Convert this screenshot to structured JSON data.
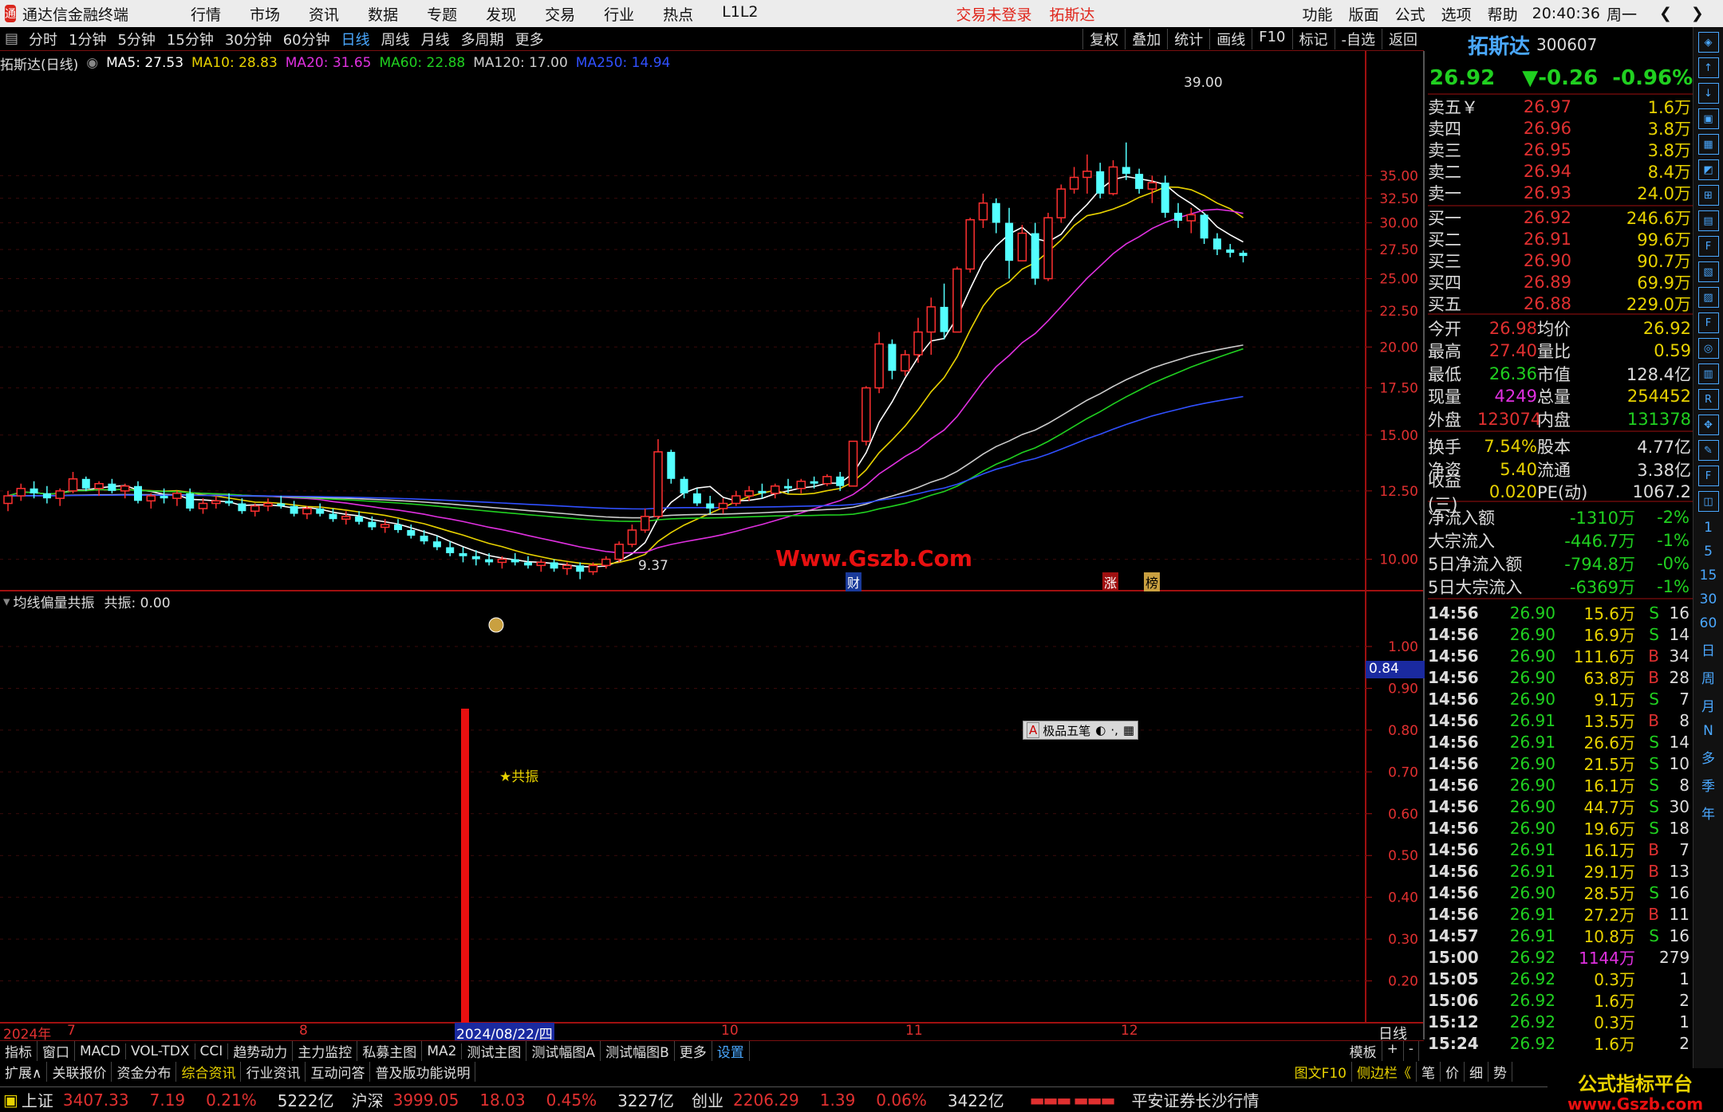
{
  "titlebar": {
    "app_name": "通达信金融终端",
    "menu": [
      "行情",
      "市场",
      "资讯",
      "数据",
      "专题",
      "发现",
      "交易",
      "行业",
      "热点",
      "L1L2"
    ],
    "trade_status": "交易未登录",
    "stock_name": "拓斯达",
    "right_menu": [
      "功能",
      "版面",
      "公式",
      "选项",
      "帮助"
    ],
    "time": "20:40:36",
    "weekday": "周一"
  },
  "period_tabs": [
    "分时",
    "1分钟",
    "5分钟",
    "15分钟",
    "30分钟",
    "60分钟",
    "日线",
    "周线",
    "月线",
    "多周期",
    "更多"
  ],
  "active_period": "日线",
  "chart_tools": [
    "复权",
    "叠加",
    "统计",
    "画线",
    "F10",
    "标记",
    "-自选",
    "返回"
  ],
  "ma_legend": {
    "title": "拓斯达(日线)",
    "items": [
      {
        "label": "MA5: 27.53",
        "color": "#ffffff"
      },
      {
        "label": "MA10: 28.83",
        "color": "#e8d200"
      },
      {
        "label": "MA20: 31.65",
        "color": "#e030e0"
      },
      {
        "label": "MA60: 22.88",
        "color": "#20d020"
      },
      {
        "label": "MA120: 17.00",
        "color": "#cccccc"
      },
      {
        "label": "MA250: 14.94",
        "color": "#3050ff"
      }
    ]
  },
  "price_axis": [
    "35.00",
    "32.50",
    "30.00",
    "27.50",
    "25.00",
    "22.50",
    "20.00",
    "17.50",
    "15.00",
    "12.50",
    "10.00"
  ],
  "annotations": {
    "high": "39.00",
    "low": "9.37",
    "watermark": "Www.Gszb.Com",
    "markers": [
      "财",
      "涨",
      "榜"
    ]
  },
  "sub_chart": {
    "legend_name": "均线偏量共振",
    "legend_value": "共振: 0.00",
    "axis": [
      "1.00",
      "0.90",
      "0.80",
      "0.70",
      "0.60",
      "0.50",
      "0.40",
      "0.30",
      "0.20"
    ],
    "current_value": "0.84",
    "signal_label": "★共振",
    "ime_label": "极品五笔"
  },
  "time_axis": {
    "labels": [
      "2024年",
      "7",
      "8",
      "2024/08/22/四",
      "10",
      "11",
      "12"
    ],
    "period": "日线"
  },
  "stock": {
    "name": "拓斯达",
    "code": "300607",
    "price": "26.92",
    "change": "▼-0.26",
    "pct": "-0.96%"
  },
  "order_book": {
    "asks": [
      {
        "label": "卖五￥",
        "price": "26.97",
        "vol": "1.6万"
      },
      {
        "label": "卖四",
        "price": "26.96",
        "vol": "3.8万"
      },
      {
        "label": "卖三",
        "price": "26.95",
        "vol": "3.8万"
      },
      {
        "label": "卖二",
        "price": "26.94",
        "vol": "8.4万"
      },
      {
        "label": "卖一",
        "price": "26.93",
        "vol": "24.0万"
      }
    ],
    "bids": [
      {
        "label": "买一",
        "price": "26.92",
        "vol": "246.6万"
      },
      {
        "label": "买二",
        "price": "26.91",
        "vol": "99.6万"
      },
      {
        "label": "买三",
        "price": "26.90",
        "vol": "90.7万"
      },
      {
        "label": "买四",
        "price": "26.89",
        "vol": "69.9万"
      },
      {
        "label": "买五",
        "price": "26.88",
        "vol": "229.0万"
      }
    ]
  },
  "stats": [
    [
      {
        "k": "今开",
        "v": "26.98",
        "c": "#e03030"
      },
      {
        "k": "均价",
        "v": "26.92",
        "c": "#e8d200"
      }
    ],
    [
      {
        "k": "最高",
        "v": "27.40",
        "c": "#e03030"
      },
      {
        "k": "量比",
        "v": "0.59",
        "c": "#e8d200"
      }
    ],
    [
      {
        "k": "最低",
        "v": "26.36",
        "c": "#20d020"
      },
      {
        "k": "市值",
        "v": "128.4亿",
        "c": "#ddd"
      }
    ],
    [
      {
        "k": "现量",
        "v": "4249",
        "c": "#e030e0"
      },
      {
        "k": "总量",
        "v": "254452",
        "c": "#e8d200"
      }
    ],
    [
      {
        "k": "外盘",
        "v": "123074",
        "c": "#e03030"
      },
      {
        "k": "内盘",
        "v": "131378",
        "c": "#20d020"
      }
    ],
    [
      {
        "k": "换手",
        "v": "7.54%",
        "c": "#e8d200"
      },
      {
        "k": "股本",
        "v": "4.77亿",
        "c": "#ddd"
      }
    ],
    [
      {
        "k": "净资",
        "v": "5.40",
        "c": "#e8d200"
      },
      {
        "k": "流通",
        "v": "3.38亿",
        "c": "#ddd"
      }
    ],
    [
      {
        "k": "收益(三)",
        "v": "0.020",
        "c": "#e8d200"
      },
      {
        "k": "PE(动)",
        "v": "1067.2",
        "c": "#ddd"
      }
    ]
  ],
  "flows": [
    {
      "k": "净流入额",
      "v": "-1310万",
      "p": "-2%"
    },
    {
      "k": "大宗流入",
      "v": "-446.7万",
      "p": "-1%"
    },
    {
      "k": "5日净流入额",
      "v": "-794.8万",
      "p": "-0%"
    },
    {
      "k": "5日大宗流入",
      "v": "-6369万",
      "p": "-1%"
    }
  ],
  "ticks": [
    {
      "t": "14:56",
      "p": "26.90",
      "v": "15.6万",
      "s": "S",
      "n": "16"
    },
    {
      "t": "14:56",
      "p": "26.90",
      "v": "16.9万",
      "s": "S",
      "n": "14"
    },
    {
      "t": "14:56",
      "p": "26.90",
      "v": "111.6万",
      "s": "B",
      "n": "34"
    },
    {
      "t": "14:56",
      "p": "26.90",
      "v": "63.8万",
      "s": "B",
      "n": "28"
    },
    {
      "t": "14:56",
      "p": "26.90",
      "v": "9.1万",
      "s": "S",
      "n": "7"
    },
    {
      "t": "14:56",
      "p": "26.91",
      "v": "13.5万",
      "s": "B",
      "n": "8"
    },
    {
      "t": "14:56",
      "p": "26.91",
      "v": "26.6万",
      "s": "S",
      "n": "14"
    },
    {
      "t": "14:56",
      "p": "26.90",
      "v": "21.5万",
      "s": "S",
      "n": "10"
    },
    {
      "t": "14:56",
      "p": "26.90",
      "v": "16.1万",
      "s": "S",
      "n": "8"
    },
    {
      "t": "14:56",
      "p": "26.90",
      "v": "44.7万",
      "s": "S",
      "n": "30"
    },
    {
      "t": "14:56",
      "p": "26.90",
      "v": "19.6万",
      "s": "S",
      "n": "18"
    },
    {
      "t": "14:56",
      "p": "26.91",
      "v": "16.1万",
      "s": "B",
      "n": "7"
    },
    {
      "t": "14:56",
      "p": "26.91",
      "v": "29.1万",
      "s": "B",
      "n": "13"
    },
    {
      "t": "14:56",
      "p": "26.90",
      "v": "28.5万",
      "s": "S",
      "n": "16"
    },
    {
      "t": "14:56",
      "p": "26.91",
      "v": "27.2万",
      "s": "B",
      "n": "11"
    },
    {
      "t": "14:57",
      "p": "26.91",
      "v": "10.8万",
      "s": "S",
      "n": "16"
    },
    {
      "t": "15:00",
      "p": "26.92",
      "v": "1144万",
      "s": "",
      "n": "279"
    },
    {
      "t": "15:05",
      "p": "26.92",
      "v": "0.3万",
      "s": "",
      "n": "1"
    },
    {
      "t": "15:06",
      "p": "26.92",
      "v": "1.6万",
      "s": "",
      "n": "2"
    },
    {
      "t": "15:12",
      "p": "26.92",
      "v": "0.3万",
      "s": "",
      "n": "1"
    },
    {
      "t": "15:24",
      "p": "26.92",
      "v": "1.6万",
      "s": "",
      "n": "2"
    }
  ],
  "side_labels": [
    "1",
    "5",
    "15",
    "30",
    "60",
    "日",
    "周",
    "月",
    "N",
    "多",
    "季",
    "年"
  ],
  "bottom_tabs": [
    "指标",
    "窗口",
    "MACD",
    "VOL-TDX",
    "CCI",
    "趋势动力",
    "主力监控",
    "私募主图",
    "MA2",
    "测试主图",
    "测试幅图A",
    "测试幅图B",
    "更多",
    "设置"
  ],
  "bottom_right": [
    "模板",
    "+",
    "-"
  ],
  "bottom_tabs2": [
    "扩展∧",
    "关联报价",
    "资金分布",
    "综合资讯",
    "行业资讯",
    "互动问答",
    "普及版功能说明"
  ],
  "bottom_tabs2_right": [
    "图文F10",
    "侧边栏《",
    "笔",
    "价",
    "细",
    "势"
  ],
  "status": {
    "sh_name": "上证",
    "sh_val": "3407.33",
    "sh_chg": "7.19",
    "sh_pct": "0.21%",
    "sh_amt": "5222亿",
    "hs_name": "沪深",
    "hs_val": "3999.05",
    "hs_chg": "18.03",
    "hs_pct": "0.45%",
    "hs_amt": "3227亿",
    "cy_name": "创业",
    "cy_val": "2206.29",
    "cy_chg": "1.39",
    "cy_pct": "0.06%",
    "cy_amt": "3422亿",
    "broker": "平安证券长沙行情",
    "logo_text": "公式指标平台",
    "logo_url": "www.Gszb.com"
  },
  "chart_data": {
    "type": "candlestick",
    "ylim": [
      8.5,
      40
    ],
    "candles": [
      [
        12.0,
        12.5,
        11.7,
        12.3
      ],
      [
        12.3,
        12.8,
        12.1,
        12.6
      ],
      [
        12.6,
        12.9,
        12.2,
        12.4
      ],
      [
        12.4,
        12.7,
        12.0,
        12.2
      ],
      [
        12.2,
        12.6,
        11.9,
        12.5
      ],
      [
        12.5,
        13.3,
        12.4,
        13.0
      ],
      [
        13.0,
        13.1,
        12.5,
        12.6
      ],
      [
        12.6,
        12.9,
        12.3,
        12.8
      ],
      [
        12.8,
        13.0,
        12.4,
        12.5
      ],
      [
        12.5,
        12.8,
        12.2,
        12.7
      ],
      [
        12.7,
        12.9,
        12.0,
        12.1
      ],
      [
        12.1,
        12.4,
        11.8,
        12.3
      ],
      [
        12.3,
        12.6,
        12.0,
        12.2
      ],
      [
        12.2,
        12.5,
        11.9,
        12.4
      ],
      [
        12.4,
        12.6,
        11.7,
        11.8
      ],
      [
        11.8,
        12.2,
        11.6,
        12.0
      ],
      [
        12.0,
        12.3,
        11.8,
        12.1
      ],
      [
        12.1,
        12.4,
        11.9,
        12.0
      ],
      [
        12.0,
        12.2,
        11.6,
        11.7
      ],
      [
        11.7,
        12.0,
        11.5,
        11.9
      ],
      [
        11.9,
        12.2,
        11.7,
        12.0
      ],
      [
        12.0,
        12.3,
        11.8,
        11.9
      ],
      [
        11.9,
        12.1,
        11.5,
        11.6
      ],
      [
        11.6,
        11.9,
        11.4,
        11.8
      ],
      [
        11.8,
        12.0,
        11.5,
        11.6
      ],
      [
        11.6,
        11.8,
        11.3,
        11.4
      ],
      [
        11.4,
        11.7,
        11.2,
        11.5
      ],
      [
        11.5,
        11.7,
        11.2,
        11.3
      ],
      [
        11.3,
        11.5,
        11.0,
        11.1
      ],
      [
        11.1,
        11.4,
        10.9,
        11.2
      ],
      [
        11.2,
        11.4,
        10.9,
        11.0
      ],
      [
        11.0,
        11.2,
        10.7,
        10.8
      ],
      [
        10.8,
        11.0,
        10.5,
        10.6
      ],
      [
        10.6,
        10.8,
        10.3,
        10.4
      ],
      [
        10.4,
        10.6,
        10.1,
        10.2
      ],
      [
        10.2,
        10.4,
        9.9,
        10.1
      ],
      [
        10.1,
        10.3,
        9.8,
        10.0
      ],
      [
        10.0,
        10.2,
        9.8,
        9.9
      ],
      [
        9.9,
        10.1,
        9.7,
        10.0
      ],
      [
        10.0,
        10.2,
        9.8,
        9.9
      ],
      [
        9.9,
        10.1,
        9.7,
        9.8
      ],
      [
        9.8,
        10.0,
        9.6,
        9.9
      ],
      [
        9.9,
        10.0,
        9.6,
        9.7
      ],
      [
        9.7,
        9.9,
        9.5,
        9.8
      ],
      [
        9.8,
        9.9,
        9.37,
        9.6
      ],
      [
        9.6,
        9.9,
        9.5,
        9.8
      ],
      [
        9.8,
        10.1,
        9.7,
        10.0
      ],
      [
        10.0,
        10.6,
        9.9,
        10.5
      ],
      [
        10.5,
        11.2,
        10.4,
        11.0
      ],
      [
        11.0,
        11.8,
        10.9,
        11.5
      ],
      [
        11.5,
        14.8,
        11.4,
        14.2
      ],
      [
        14.2,
        14.3,
        12.8,
        13.0
      ],
      [
        13.0,
        13.1,
        12.2,
        12.4
      ],
      [
        12.4,
        12.6,
        11.9,
        12.0
      ],
      [
        12.0,
        12.3,
        11.6,
        11.8
      ],
      [
        11.8,
        12.2,
        11.6,
        12.0
      ],
      [
        12.0,
        12.5,
        11.9,
        12.3
      ],
      [
        12.3,
        12.7,
        12.1,
        12.5
      ],
      [
        12.5,
        12.8,
        12.2,
        12.4
      ],
      [
        12.4,
        12.8,
        12.2,
        12.7
      ],
      [
        12.7,
        13.0,
        12.4,
        12.6
      ],
      [
        12.6,
        13.0,
        12.4,
        12.9
      ],
      [
        12.9,
        13.1,
        12.6,
        12.8
      ],
      [
        12.8,
        13.2,
        12.7,
        13.1
      ],
      [
        13.1,
        13.3,
        12.5,
        12.7
      ],
      [
        12.7,
        14.7,
        12.7,
        14.7
      ],
      [
        14.7,
        17.6,
        14.5,
        17.5
      ],
      [
        17.5,
        21.0,
        17.2,
        20.2
      ],
      [
        20.2,
        20.5,
        18.0,
        18.5
      ],
      [
        18.5,
        19.8,
        18.2,
        19.5
      ],
      [
        19.5,
        22.0,
        19.0,
        21.0
      ],
      [
        21.0,
        23.5,
        19.5,
        22.8
      ],
      [
        22.8,
        24.6,
        20.5,
        21.0
      ],
      [
        21.0,
        26.0,
        21.0,
        25.8
      ],
      [
        25.8,
        30.5,
        25.5,
        30.3
      ],
      [
        30.3,
        33.0,
        29.5,
        32.0
      ],
      [
        32.0,
        32.5,
        29.0,
        30.0
      ],
      [
        30.0,
        31.5,
        25.0,
        26.5
      ],
      [
        26.5,
        29.8,
        26.5,
        29.0
      ],
      [
        29.0,
        30.0,
        24.5,
        25.0
      ],
      [
        25.0,
        31.0,
        24.8,
        30.5
      ],
      [
        30.5,
        34.0,
        30.0,
        33.5
      ],
      [
        33.5,
        36.0,
        33.0,
        34.8
      ],
      [
        34.8,
        37.5,
        33.0,
        35.5
      ],
      [
        35.5,
        36.5,
        32.5,
        33.0
      ],
      [
        33.0,
        36.8,
        32.8,
        36.0
      ],
      [
        36.0,
        39.0,
        34.5,
        35.2
      ],
      [
        35.2,
        35.8,
        33.0,
        33.5
      ],
      [
        33.5,
        35.0,
        32.0,
        34.2
      ],
      [
        34.2,
        35.0,
        30.5,
        31.0
      ],
      [
        31.0,
        32.0,
        29.5,
        30.2
      ],
      [
        30.2,
        31.5,
        29.0,
        30.8
      ],
      [
        30.8,
        31.0,
        28.0,
        28.5
      ],
      [
        28.5,
        29.0,
        27.0,
        27.5
      ],
      [
        27.5,
        28.0,
        26.8,
        27.2
      ],
      [
        27.2,
        27.4,
        26.36,
        26.92
      ]
    ]
  }
}
